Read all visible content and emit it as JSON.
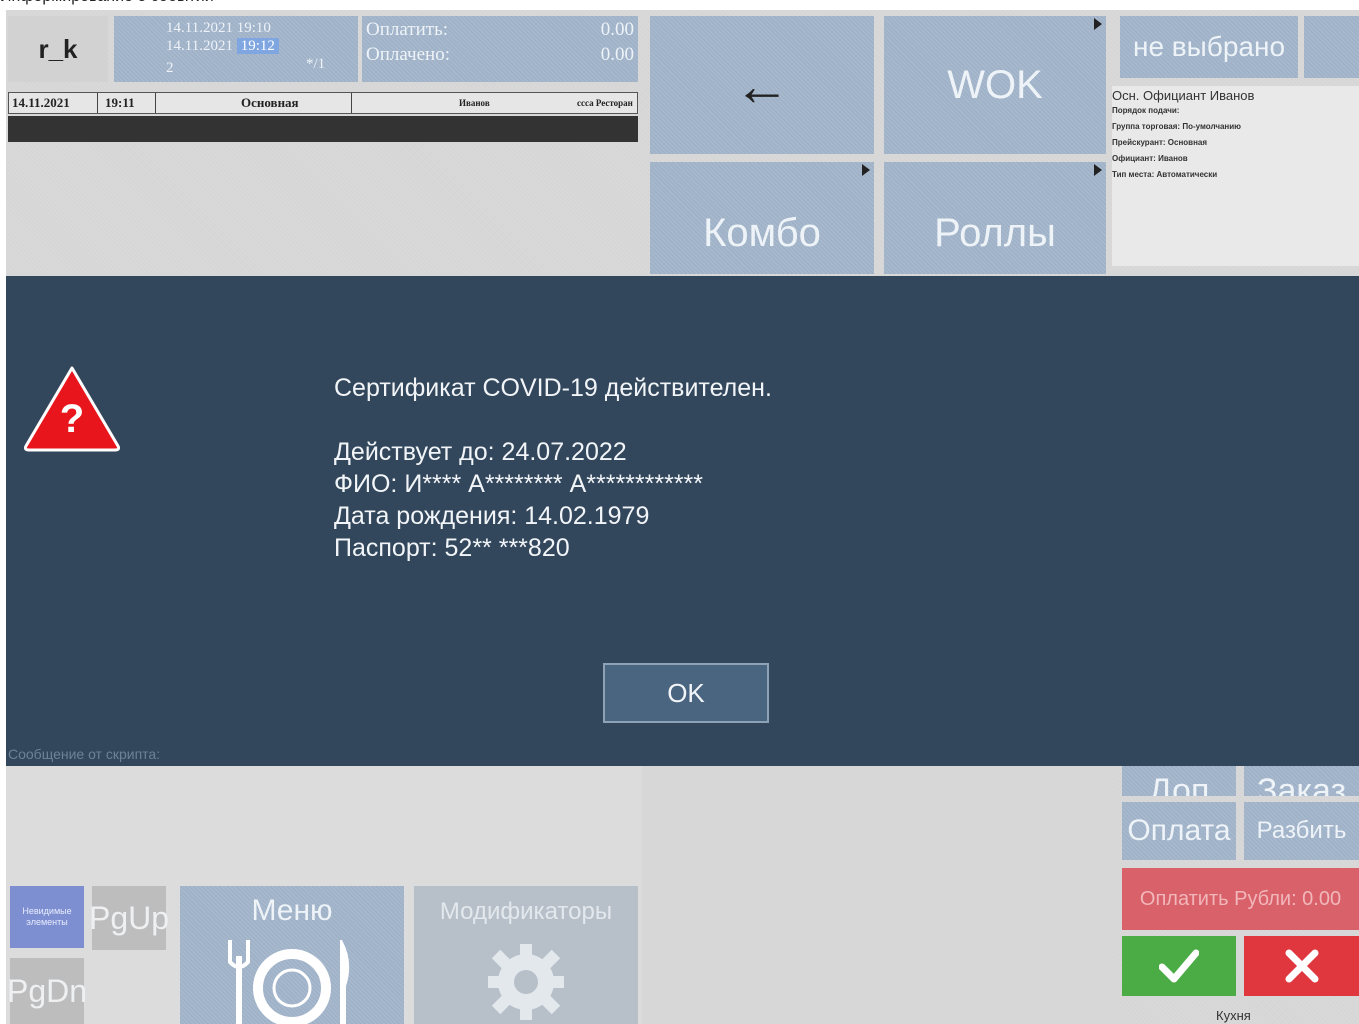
{
  "window": {
    "caption_cut": "Информирование о событии"
  },
  "header": {
    "logo": "r_k",
    "time_line1": "14.11.2021 19:10",
    "time_line2_date": "14.11.2021",
    "time_line2_time": "19:12",
    "time_line3_left": "2",
    "time_line3_right": "*/1",
    "pay_label": "Оплатить:",
    "pay_value": "0.00",
    "paid_label": "Оплачено:",
    "paid_value": "0.00"
  },
  "order_bar": {
    "date": "14.11.2021",
    "time": "19:11",
    "menu": "Основная",
    "waiter": "Иванов",
    "restaurant": "ссса Ресторан"
  },
  "tiles": {
    "back_arrow": "←",
    "wok": "WOK",
    "combo": "Комбо",
    "rolls": "Роллы",
    "not_selected": "не выбрано"
  },
  "info": {
    "main": "Осн. Официант  Иванов",
    "line1": "Порядок подачи:",
    "line2": "Группа торговая: По-умолчанию",
    "line3": "Прейскурант: Основная",
    "line4": "Официант: Иванов",
    "line5": "Тип места: Автоматически"
  },
  "dialog": {
    "icon": "question-warning-icon",
    "line1": "Сертификат COVID-19 действителен.",
    "line2": "Действует до: 24.07.2022",
    "line3": "ФИО: И**** А******** А************",
    "line4": "Дата рождения: 14.02.1979",
    "line5": "Паспорт: 52** ***820",
    "ok": "OK",
    "script_caption": "Сообщение от скрипта:"
  },
  "bottom_right": {
    "dop": "Доп",
    "zakaz": "Заказ",
    "oplata": "Оплата",
    "razbit": "Разбить",
    "pay_rub": "Оплатить Рубли: 0.00",
    "kitchen": "Кухня"
  },
  "bottom_left": {
    "hidden_elements": "Невидимые элементы",
    "pgup": "PgUp",
    "pgdn": "PgDn",
    "menu": "Меню",
    "modifiers": "Модификаторы"
  },
  "colors": {
    "dialog_bg": "#33475c",
    "tile_bg": "#9fb2c8",
    "confirm_green": "#4bab45",
    "cancel_red": "#e0363e",
    "pay_red": "#d9616a"
  }
}
